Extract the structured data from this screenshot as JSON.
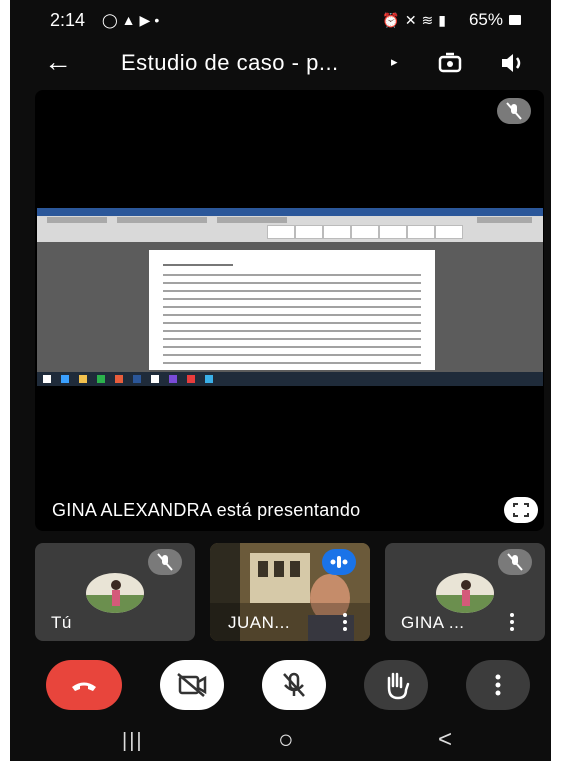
{
  "status_bar": {
    "time": "2:14",
    "left_icons": [
      "whatsapp-icon",
      "photo-icon",
      "youtube-icon",
      "dot-icon"
    ],
    "right_icons": [
      "alarm-icon",
      "mute-icon",
      "wifi-icon",
      "signal-icon"
    ],
    "battery": "65%"
  },
  "top_bar": {
    "title": "Estudio de caso - p...",
    "title_arrow": "▸",
    "back_icon": "arrow-left-icon",
    "switch_camera_icon": "switch-camera-icon",
    "speaker_icon": "speaker-icon"
  },
  "presentation": {
    "presenting_text": "GINA ALEXANDRA está presentando",
    "muted": true,
    "fullscreen_icon": "fullscreen-icon"
  },
  "participants": [
    {
      "name": "Tú",
      "muted": true,
      "more_menu": false
    },
    {
      "name": "JUAN...",
      "muted": false,
      "speaking": true,
      "more_menu": true
    },
    {
      "name": "GINA ...",
      "muted": true,
      "more_menu": true
    }
  ],
  "controls": [
    {
      "name": "end-call",
      "icon": "phone-hangup-icon",
      "color": "#e8453c"
    },
    {
      "name": "camera-off",
      "icon": "video-off-icon",
      "color": "#ffffff"
    },
    {
      "name": "mic-off",
      "icon": "mic-off-icon",
      "color": "#ffffff"
    },
    {
      "name": "raise-hand",
      "icon": "hand-icon",
      "color": "#3c3c3c"
    },
    {
      "name": "more-options",
      "icon": "more-vert-icon",
      "color": "#3c3c3c"
    }
  ],
  "nav_bar": {
    "recent": "|||",
    "home": "○",
    "back": "<"
  },
  "colors": {
    "background": "#0d0d0d",
    "tile": "#3c3c3c",
    "end_call": "#e8453c",
    "speaking_badge": "#1a73e8"
  }
}
